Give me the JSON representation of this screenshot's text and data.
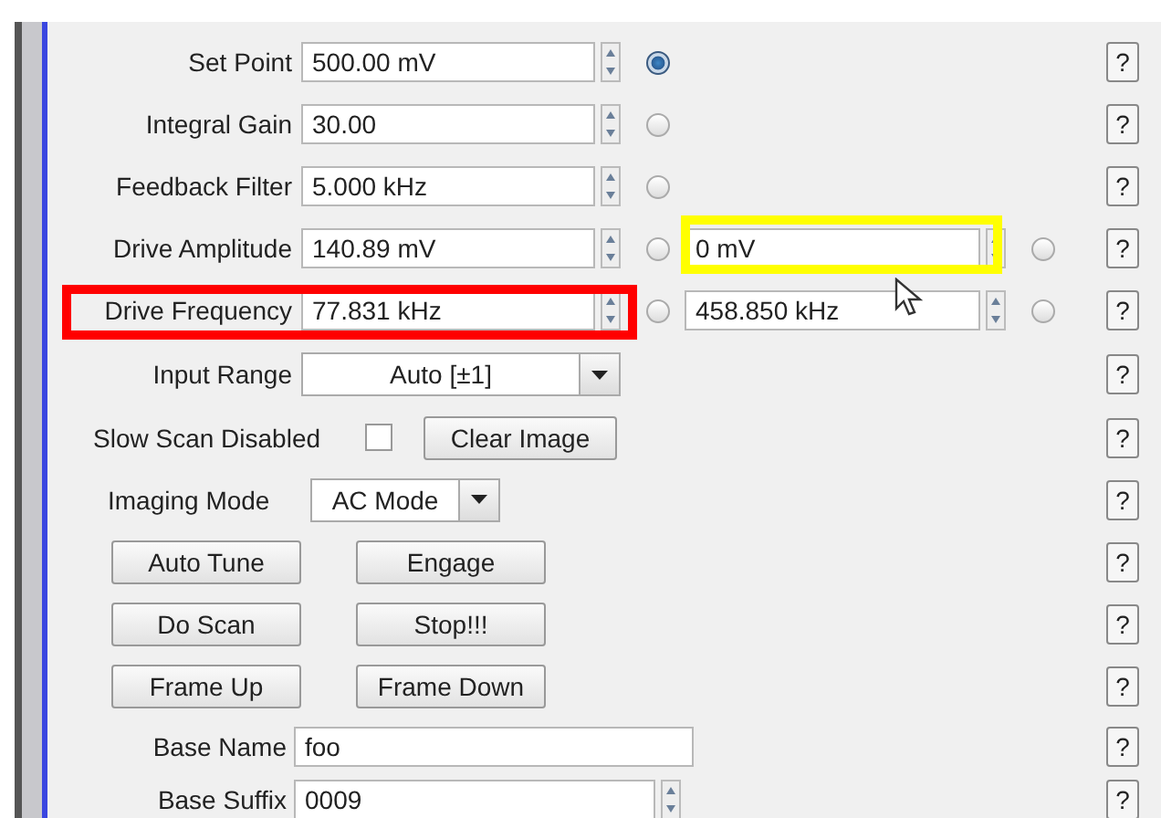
{
  "params": [
    {
      "label": "Set Point",
      "value": "500.00 mV",
      "selected": true,
      "help": "?"
    },
    {
      "label": "Integral Gain",
      "value": "30.00",
      "selected": false,
      "help": "?"
    },
    {
      "label": "Feedback Filter",
      "value": "5.000 kHz",
      "selected": false,
      "help": "?"
    },
    {
      "label": "Drive Amplitude",
      "value": "140.89 mV",
      "selected": false,
      "secondary": {
        "value": "0 mV",
        "selected": false,
        "highlight": {
          "color": "#ffff00"
        }
      },
      "help": "?"
    },
    {
      "label": "Drive Frequency",
      "value": "77.831 kHz",
      "selected": false,
      "highlight": {
        "color": "#ff0000"
      },
      "secondary": {
        "value": "458.850 kHz",
        "selected": false
      },
      "help": "?"
    }
  ],
  "input_range": {
    "label": "Input Range",
    "value": "Auto [±1]",
    "help": "?"
  },
  "slow_scan": {
    "label": "Slow Scan Disabled",
    "checked": false,
    "button": "Clear Image",
    "help": "?"
  },
  "imaging_mode": {
    "label": "Imaging Mode",
    "value": "AC Mode",
    "help": "?"
  },
  "button_rows": [
    {
      "buttons": [
        "Auto Tune",
        "Engage"
      ],
      "help": "?"
    },
    {
      "buttons": [
        "Do Scan",
        "Stop!!!"
      ],
      "help": "?"
    },
    {
      "buttons": [
        "Frame Up",
        "Frame Down"
      ],
      "help": "?"
    }
  ],
  "base_name": {
    "label": "Base Name",
    "value": "foo",
    "help": "?"
  },
  "base_suffix": {
    "label": "Base Suffix",
    "value": "0009",
    "help": "?"
  }
}
